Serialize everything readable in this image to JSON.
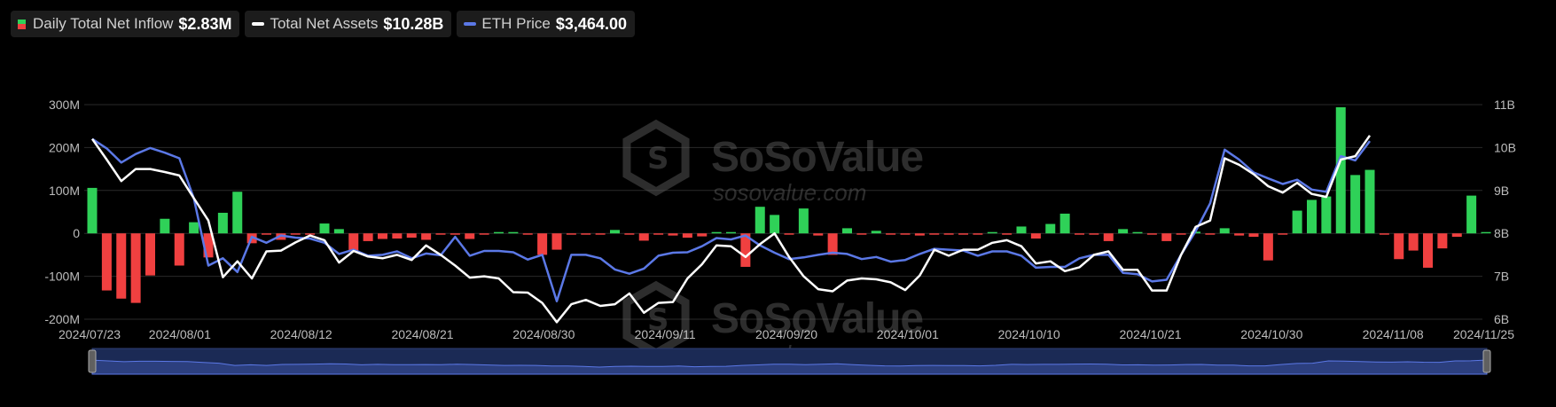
{
  "legend": [
    {
      "label": "Daily Total Net Inflow",
      "value": "$2.83M"
    },
    {
      "label": "Total Net Assets",
      "value": "$10.28B"
    },
    {
      "label": "ETH Price",
      "value": "$3,464.00"
    }
  ],
  "watermark": {
    "brand": "SoSoValue",
    "url": "sosovalue.com"
  },
  "colors": {
    "inflow": "#2fd158",
    "outflow": "#f04040",
    "assets": "#ffffff",
    "eth": "#5b78e6",
    "grid": "#2a2a2a"
  },
  "chart_data": {
    "type": "bar+line",
    "x_tick_labels": [
      "2024/07/23",
      "2024/08/01",
      "2024/08/12",
      "2024/08/21",
      "2024/08/30",
      "2024/09/11",
      "2024/09/20",
      "2024/10/01",
      "2024/10/10",
      "2024/10/21",
      "2024/10/30",
      "2024/11/08",
      "2024/11/25"
    ],
    "left_axis": {
      "labels": [
        "300M",
        "200M",
        "100M",
        "0",
        "-100M",
        "-200M"
      ],
      "ylim": [
        -200,
        300
      ],
      "unit": "M"
    },
    "right_axis": {
      "labels": [
        "11B",
        "10B",
        "9B",
        "8B",
        "7B",
        "6B"
      ],
      "ylim": [
        6,
        11
      ],
      "unit": "B"
    },
    "grid": true,
    "series": [
      {
        "name": "Daily Total Net Inflow",
        "type": "bar",
        "axis": "left",
        "values": [
          106,
          -133,
          -152,
          -162,
          -98,
          34,
          -75,
          26,
          -56,
          48,
          97,
          -23,
          -3,
          -15,
          -3,
          -1,
          23,
          10,
          -42,
          -18,
          -13,
          -12,
          -10,
          -15,
          -3,
          -3,
          -13,
          -3,
          2,
          3,
          -1,
          -50,
          -38,
          -3,
          -3,
          -3,
          8,
          -3,
          -17,
          -3,
          -5,
          -10,
          -7,
          3,
          3,
          -78,
          62,
          43,
          -3,
          58,
          -5,
          -50,
          12,
          -3,
          6,
          -2,
          -3,
          -5,
          -3,
          -3,
          -2,
          -3,
          1,
          -3,
          16,
          -12,
          22,
          46,
          -3,
          -3,
          -18,
          10,
          2,
          -3,
          -18,
          -3,
          4,
          -3,
          12,
          -5,
          -8,
          -63,
          -3,
          53,
          78,
          86,
          294,
          136,
          148,
          -3,
          -60,
          -40,
          -80,
          -35,
          -8,
          88,
          3
        ]
      },
      {
        "name": "Total Net Assets",
        "type": "line",
        "axis": "right",
        "values": [
          10.2,
          9.72,
          9.22,
          9.5,
          9.5,
          9.43,
          9.35,
          8.82,
          8.3,
          6.98,
          7.35,
          6.95,
          7.58,
          7.6,
          7.79,
          7.95,
          7.84,
          7.32,
          7.59,
          7.46,
          7.42,
          7.5,
          7.38,
          7.72,
          7.5,
          7.25,
          6.97,
          7.0,
          6.95,
          6.63,
          6.62,
          6.38,
          5.93,
          6.35,
          6.45,
          6.31,
          6.35,
          6.6,
          6.15,
          6.38,
          6.4,
          6.95,
          7.28,
          7.72,
          7.7,
          7.45,
          7.75,
          8.0,
          7.45,
          7.0,
          6.7,
          6.65,
          6.9,
          6.95,
          6.93,
          6.86,
          6.68,
          7.02,
          7.62,
          7.48,
          7.62,
          7.62,
          7.78,
          7.84,
          7.7,
          7.3,
          7.35,
          7.12,
          7.21,
          7.5,
          7.58,
          7.15,
          7.15,
          6.67,
          6.67,
          7.5,
          8.15,
          8.3,
          9.75,
          9.6,
          9.38,
          9.1,
          8.95,
          9.18,
          8.92,
          8.85,
          9.72,
          9.8,
          10.28
        ]
      },
      {
        "name": "ETH Price",
        "type": "line",
        "axis": "right",
        "values": [
          10.2,
          9.98,
          9.65,
          9.85,
          9.99,
          9.88,
          9.75,
          8.82,
          7.25,
          7.42,
          7.1,
          7.92,
          7.78,
          7.95,
          7.9,
          7.88,
          7.78,
          7.52,
          7.62,
          7.48,
          7.5,
          7.58,
          7.42,
          7.53,
          7.49,
          7.92,
          7.48,
          7.59,
          7.59,
          7.56,
          7.39,
          7.5,
          6.42,
          7.5,
          7.5,
          7.42,
          7.16,
          7.06,
          7.18,
          7.48,
          7.55,
          7.56,
          7.7,
          7.89,
          7.86,
          7.95,
          7.72,
          7.55,
          7.4,
          7.44,
          7.5,
          7.55,
          7.52,
          7.4,
          7.45,
          7.34,
          7.38,
          7.52,
          7.64,
          7.62,
          7.6,
          7.48,
          7.58,
          7.58,
          7.48,
          7.2,
          7.22,
          7.22,
          7.42,
          7.5,
          7.5,
          7.08,
          7.05,
          6.88,
          6.92,
          7.5,
          8.05,
          8.7,
          9.95,
          9.72,
          9.42,
          9.28,
          9.15,
          9.25,
          9.02,
          8.97,
          9.8,
          9.7,
          10.15
        ]
      }
    ]
  }
}
